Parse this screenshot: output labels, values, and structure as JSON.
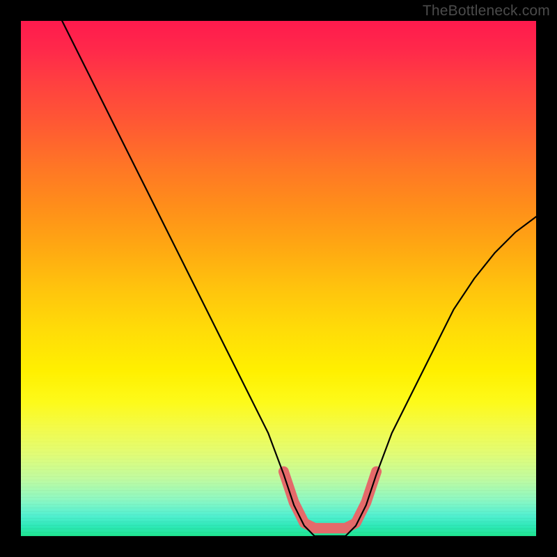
{
  "watermark": "TheBottleneck.com",
  "colors": {
    "frame_bg": "#000000",
    "curve_stroke": "#000000",
    "accent_marker": "#e46a6a",
    "gradient_top": "#ff1a4d",
    "gradient_bottom": "#1fe48f"
  },
  "chart_data": {
    "type": "line",
    "title": "",
    "xlabel": "",
    "ylabel": "",
    "xlim": [
      0,
      100
    ],
    "ylim": [
      0,
      100
    ],
    "grid": false,
    "legend": false,
    "series": [
      {
        "name": "bottleneck-curve",
        "x": [
          8,
          12,
          16,
          20,
          24,
          28,
          32,
          36,
          40,
          44,
          48,
          51,
          53,
          55,
          57,
          59,
          61,
          63,
          65,
          67,
          69,
          72,
          76,
          80,
          84,
          88,
          92,
          96,
          100
        ],
        "values": [
          100,
          92,
          84,
          76,
          68,
          60,
          52,
          44,
          36,
          28,
          20,
          12,
          6,
          2,
          0,
          0,
          0,
          0,
          2,
          6,
          12,
          20,
          28,
          36,
          44,
          50,
          55,
          59,
          62
        ]
      }
    ],
    "accent_region": {
      "name": "optimal-range-marker",
      "x_start": 51,
      "x_end": 69,
      "y": 1
    },
    "background_gradient": {
      "orientation": "vertical",
      "stops": [
        {
          "pos": 0.0,
          "color": "#ff1a4d"
        },
        {
          "pos": 0.2,
          "color": "#ff5933"
        },
        {
          "pos": 0.44,
          "color": "#ffa812"
        },
        {
          "pos": 0.68,
          "color": "#fff000"
        },
        {
          "pos": 0.89,
          "color": "#bffba1"
        },
        {
          "pos": 1.0,
          "color": "#1fe48f"
        }
      ]
    }
  }
}
